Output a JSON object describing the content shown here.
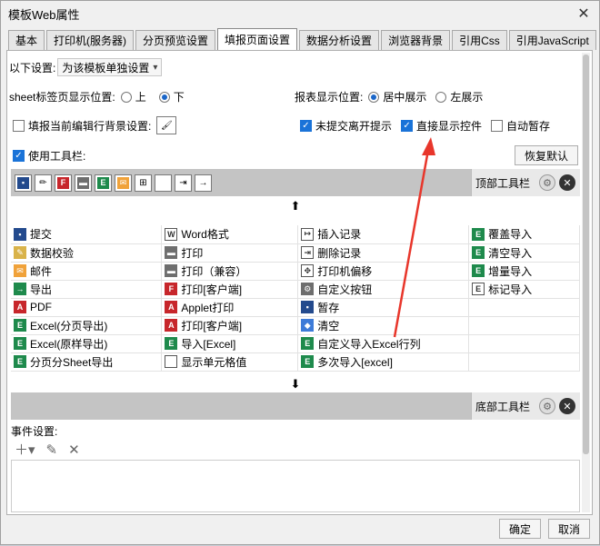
{
  "window": {
    "title": "模板Web属性"
  },
  "tabs": [
    {
      "label": "基本"
    },
    {
      "label": "打印机(服务器)"
    },
    {
      "label": "分页预览设置"
    },
    {
      "label": "填报页面设置",
      "active": true
    },
    {
      "label": "数据分析设置"
    },
    {
      "label": "浏览器背景"
    },
    {
      "label": "引用Css"
    },
    {
      "label": "引用JavaScript"
    }
  ],
  "settings": {
    "scope_label": "以下设置:",
    "scope_value": "为该模板单独设置",
    "sheet_pos_label": "sheet标签页显示位置:",
    "sheet_pos_top": "上",
    "sheet_pos_bottom": "下",
    "report_pos_label": "报表显示位置:",
    "report_pos_center": "居中展示",
    "report_pos_left": "左展示",
    "fill_bg_label": "填报当前编辑行背景设置:",
    "unsubmitted_leave": "未提交离开提示",
    "direct_show_controls": "直接显示控件",
    "autosave": "自动暂存",
    "use_toolbar": "使用工具栏:",
    "restore_default": "恢复默认"
  },
  "toolbar": {
    "top_label": "顶部工具栏",
    "bottom_label": "底部工具栏",
    "icons": [
      "save-icon",
      "pencil-icon",
      "flash-print-icon",
      "print-icon",
      "excel-icon",
      "email-icon",
      "insert-row-icon",
      "blank-icon",
      "import-icon",
      "arrow-icon"
    ]
  },
  "grid": {
    "rows": [
      [
        {
          "icon": "save",
          "text": "提交"
        },
        {
          "icon": "word",
          "text": "Word格式"
        },
        {
          "icon": "insert",
          "text": "插入记录"
        },
        {
          "icon": "excel",
          "text": "覆盖导入"
        }
      ],
      [
        {
          "icon": "pencil",
          "text": "数据校验"
        },
        {
          "icon": "print",
          "text": "打印"
        },
        {
          "icon": "delete",
          "text": "删除记录"
        },
        {
          "icon": "excel",
          "text": "清空导入"
        }
      ],
      [
        {
          "icon": "email",
          "text": "邮件"
        },
        {
          "icon": "print",
          "text": "打印（兼容）"
        },
        {
          "icon": "move",
          "text": "打印机偏移"
        },
        {
          "icon": "excel",
          "text": "增量导入"
        }
      ],
      [
        {
          "icon": "export",
          "text": "导出"
        },
        {
          "icon": "flash",
          "text": "打印[客户端]"
        },
        {
          "icon": "gear",
          "text": "自定义按钮"
        },
        {
          "icon": "mark",
          "text": "标记导入"
        }
      ],
      [
        {
          "icon": "pdf",
          "text": "PDF"
        },
        {
          "icon": "pdf",
          "text": "Applet打印"
        },
        {
          "icon": "save",
          "text": "暂存"
        },
        {
          "icon": "",
          "text": ""
        }
      ],
      [
        {
          "icon": "excel",
          "text": "Excel(分页导出)"
        },
        {
          "icon": "pdf",
          "text": "打印[客户端]"
        },
        {
          "icon": "clear",
          "text": "清空"
        },
        {
          "icon": "",
          "text": ""
        }
      ],
      [
        {
          "icon": "excel",
          "text": "Excel(原样导出)"
        },
        {
          "icon": "excel",
          "text": "导入[Excel]"
        },
        {
          "icon": "excel",
          "text": "自定义导入Excel行列"
        },
        {
          "icon": "",
          "text": ""
        }
      ],
      [
        {
          "icon": "excel",
          "text": "分页分Sheet导出"
        },
        {
          "icon": "blank",
          "text": "显示单元格值"
        },
        {
          "icon": "excel",
          "text": "多次导入[excel]"
        },
        {
          "icon": "",
          "text": ""
        }
      ]
    ]
  },
  "events": {
    "label": "事件设置:"
  },
  "footer": {
    "ok": "确定",
    "cancel": "取消"
  },
  "colors": {
    "annotation_arrow": "#e8362b"
  }
}
